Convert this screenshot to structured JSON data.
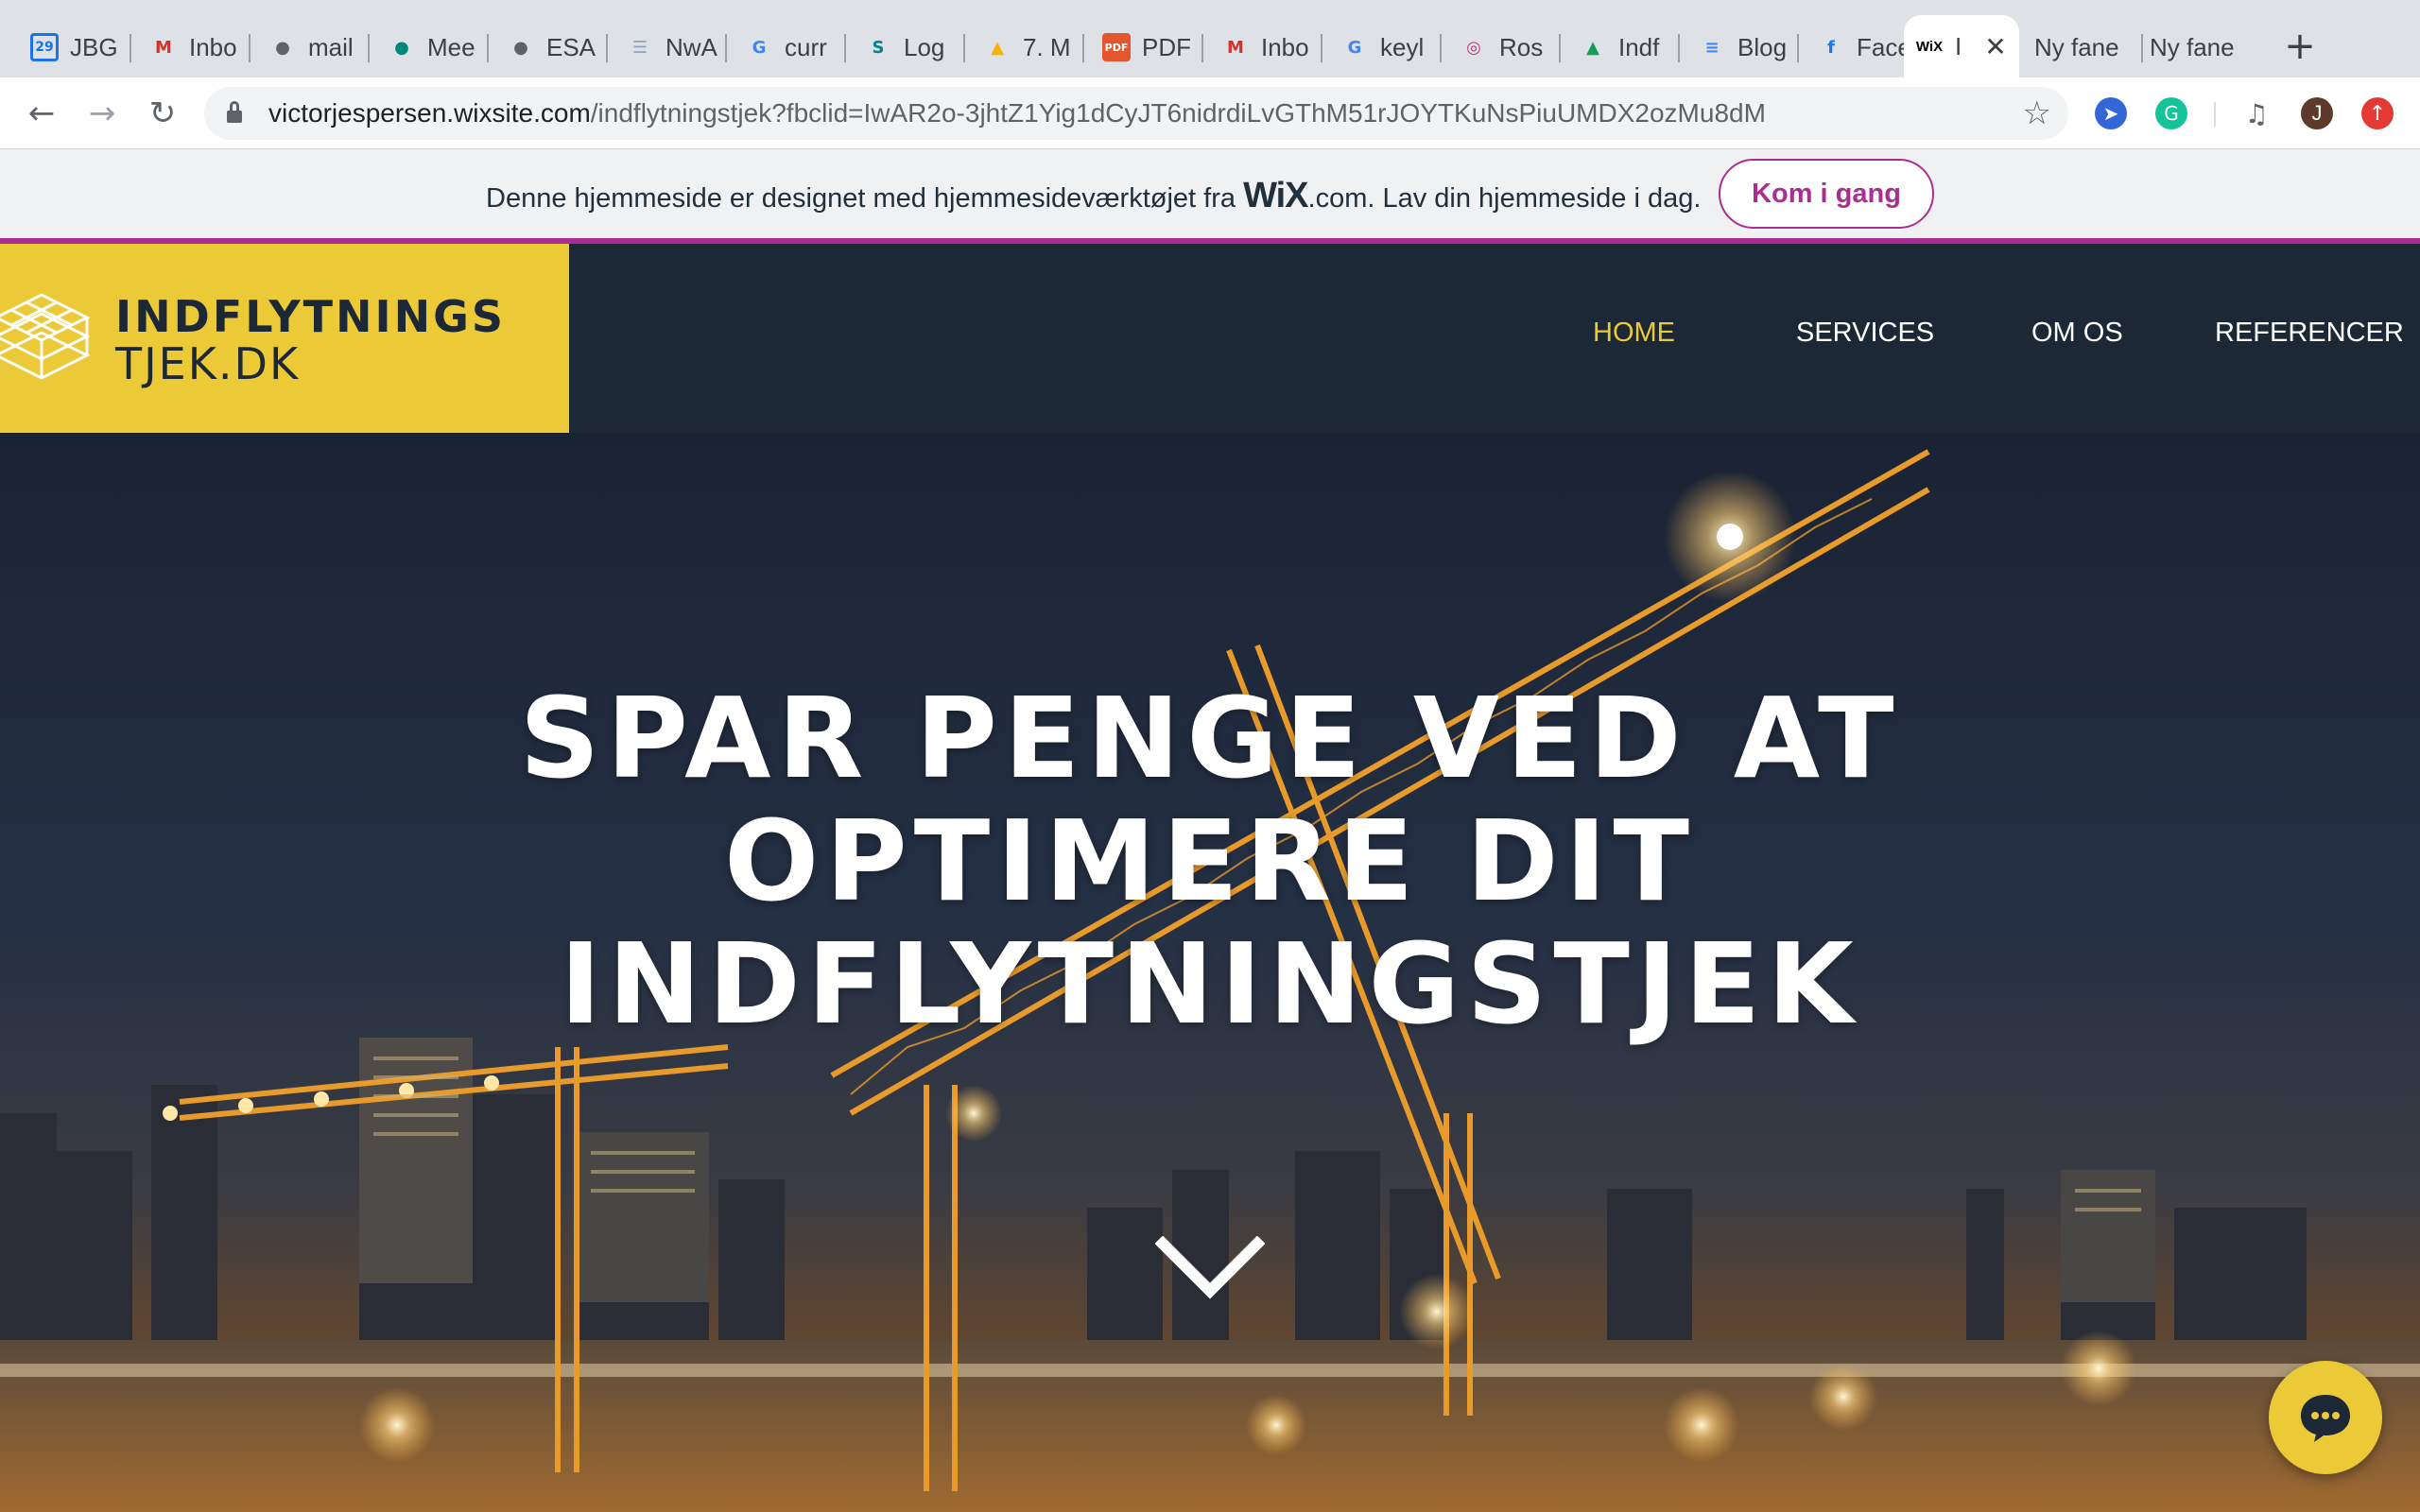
{
  "browser": {
    "tabs": [
      {
        "title": "JBG",
        "icon": "calendar-icon",
        "icon_text": "29",
        "icon_color": "#1a73e8"
      },
      {
        "title": "Inbo",
        "icon": "gmail-icon",
        "icon_text": "M",
        "icon_color": "#d93025"
      },
      {
        "title": "mail",
        "icon": "globe-icon",
        "icon_text": "●",
        "icon_color": "#5f6368"
      },
      {
        "title": "Mee",
        "icon": "meet-icon",
        "icon_text": "●",
        "icon_color": "#00897b"
      },
      {
        "title": "ESA",
        "icon": "globe-icon",
        "icon_text": "●",
        "icon_color": "#5f6368"
      },
      {
        "title": "NwA",
        "icon": "document-icon",
        "icon_text": "☰",
        "icon_color": "#8aa4c8"
      },
      {
        "title": "curr",
        "icon": "google-icon",
        "icon_text": "G",
        "icon_color": "#4285f4"
      },
      {
        "title": "Log",
        "icon": "sharepoint-icon",
        "icon_text": "S",
        "icon_color": "#038387"
      },
      {
        "title": "7. M",
        "icon": "drive-icon",
        "icon_text": "▲",
        "icon_color": "#f4b400"
      },
      {
        "title": "PDF",
        "icon": "pdf-icon",
        "icon_text": "PDF",
        "icon_color": "#e4572e"
      },
      {
        "title": "Inbo",
        "icon": "gmail-icon",
        "icon_text": "M",
        "icon_color": "#d93025"
      },
      {
        "title": "keyl",
        "icon": "google-icon",
        "icon_text": "G",
        "icon_color": "#4285f4"
      },
      {
        "title": "Ros",
        "icon": "instagram-icon",
        "icon_text": "◎",
        "icon_color": "#c13584"
      },
      {
        "title": "Indf",
        "icon": "drive-icon",
        "icon_text": "▲",
        "icon_color": "#0f9d58"
      },
      {
        "title": "Blog",
        "icon": "docs-icon",
        "icon_text": "≡",
        "icon_color": "#4285f4"
      },
      {
        "title": "Face",
        "icon": "facebook-icon",
        "icon_text": "f",
        "icon_color": "#1877f2"
      },
      {
        "title": "I",
        "icon": "wix-icon",
        "icon_text": "WiX",
        "icon_color": "#000000",
        "active": true
      },
      {
        "title": "Ny fane",
        "icon": "",
        "icon_text": "",
        "icon_color": ""
      },
      {
        "title": "Ny fane",
        "icon": "",
        "icon_text": "",
        "icon_color": ""
      }
    ],
    "close_tab_symbol": "✕",
    "new_tab_symbol": "+",
    "back_symbol": "←",
    "forward_symbol": "→",
    "reload_symbol": "↻",
    "url_host": "victorjespersen.wixsite.com",
    "url_path": "/indflytningstjek?fbclid=IwAR2o-3jhtZ1Yig1dCyJT6nidrdiLvGThM51rJOYTKuNsPiuUMDX2ozMu8dM",
    "bookmark_symbol": "☆",
    "profile_initial": "J"
  },
  "wix_banner": {
    "text_before": "Denne hjemmeside er designet med hjemmesideværktøjet fra ",
    "logo": "WiX",
    "text_after": ".com. Lav din hjemmeside i dag.",
    "cta": "Kom i gang",
    "accent": "#aa2e91"
  },
  "site": {
    "logo_line1": "INDFLYTNINGS",
    "logo_line2": "TJEK.DK",
    "brand_yellow": "#ecc936",
    "header_bg": "#1c2836",
    "nav": [
      {
        "label": "HOME",
        "active": true
      },
      {
        "label": "SERVICES",
        "active": false
      },
      {
        "label": "OM OS",
        "active": false
      },
      {
        "label": "REFERENCER",
        "active": false
      }
    ]
  },
  "hero": {
    "title_lines": [
      "SPAR PENGE VED AT",
      "OPTIMERE DIT",
      "INDFLYTNINGSTJEK"
    ],
    "scroll_icon": "chevron-down-icon",
    "chat_icon": "chat-bubble-icon"
  }
}
